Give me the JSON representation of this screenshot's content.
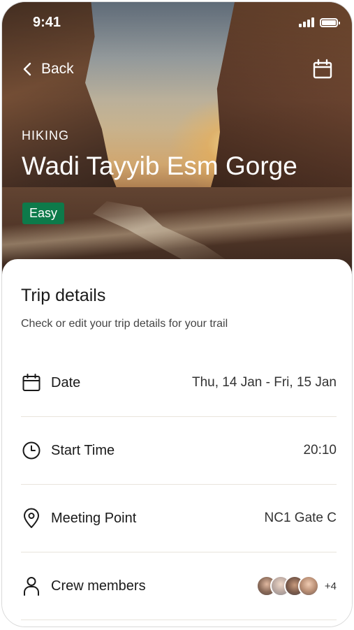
{
  "status_bar": {
    "time": "9:41"
  },
  "header": {
    "back_label": "Back",
    "category": "HIKING",
    "title": "Wadi Tayyib Esm Gorge",
    "difficulty": "Easy",
    "difficulty_color": "#0d7a4a"
  },
  "trip": {
    "title": "Trip details",
    "subtitle": "Check or edit your trip details for your trail",
    "rows": [
      {
        "icon": "calendar-icon",
        "label": "Date",
        "value": "Thu, 14 Jan - Fri, 15 Jan"
      },
      {
        "icon": "clock-icon",
        "label": "Start Time",
        "value": "20:10"
      },
      {
        "icon": "location-pin-icon",
        "label": "Meeting Point",
        "value": "NC1 Gate C"
      },
      {
        "icon": "person-icon",
        "label": "Crew members",
        "extra_count": "+4"
      }
    ]
  }
}
